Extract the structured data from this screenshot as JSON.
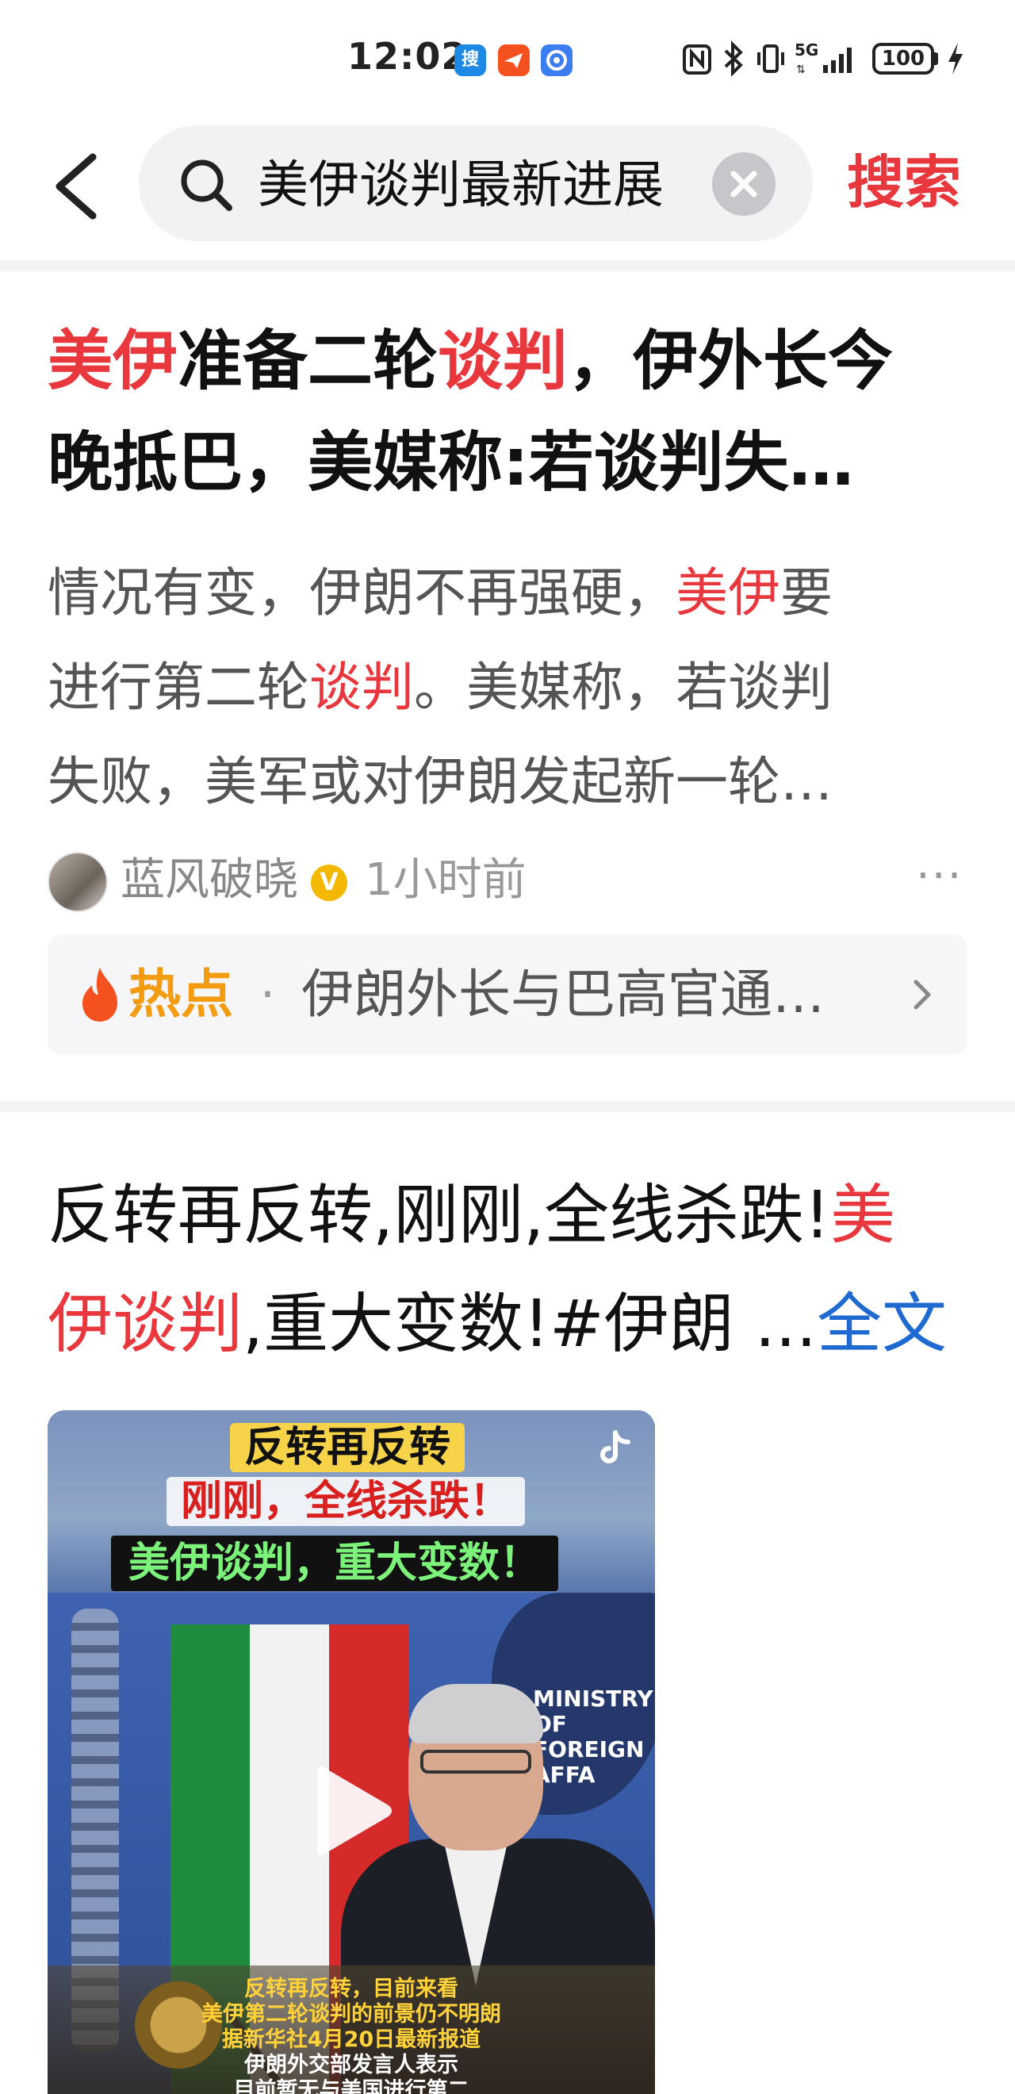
{
  "status_bar": {
    "time": "12:02",
    "app_icons": [
      "search-app-icon",
      "paper-plane-icon",
      "shield-app-icon"
    ],
    "network": "5G",
    "battery": "100"
  },
  "search": {
    "query": "美伊谈判最新进展",
    "button_label": "搜索"
  },
  "card1": {
    "title_parts": [
      {
        "text": "美伊",
        "hl": true
      },
      {
        "text": "准备二轮",
        "hl": false
      },
      {
        "text": "谈判",
        "hl": true
      },
      {
        "text": "，伊外长今",
        "hl": false
      }
    ],
    "title_line2": "晚抵巴，美媒称:若谈判失…",
    "summary_line1_a": "情况有变，伊朗不再强硬，",
    "summary_line1_hl": "美伊",
    "summary_line1_b": "要",
    "summary_line2_a": "进行第二轮",
    "summary_line2_hl": "谈判",
    "summary_line2_b": "。美媒称，若谈判",
    "summary_line3": "失败，美军或对伊朗发起新一轮…",
    "author": "蓝风破晓",
    "time_ago": "1小时前",
    "more": "···",
    "hot_label": "热点",
    "hot_dot": "·",
    "hot_text": "伊朗外长与巴高官通…"
  },
  "card2": {
    "line1_a": "反转再反转,刚刚,全线杀跌!",
    "line1_hl": "美",
    "line2_hl": "伊谈判",
    "line2_b": ",重大变数!#伊朗 ...",
    "full_text": "全文",
    "video": {
      "caption1": "反转再反转",
      "caption2": "刚刚，全线杀跌！",
      "caption3": "美伊谈判，重大变数！",
      "ministry": "MINISTRY OF FOREIGN AFFA",
      "sub1": "反转再反转，目前来看",
      "sub2": "美伊第二轮谈判的前景仍不明朗",
      "sub3": "据新华社4月20日最新报道",
      "sub4": "伊朗外交部发言人表示",
      "sub5": "目前暂无与美国进行第二"
    }
  }
}
